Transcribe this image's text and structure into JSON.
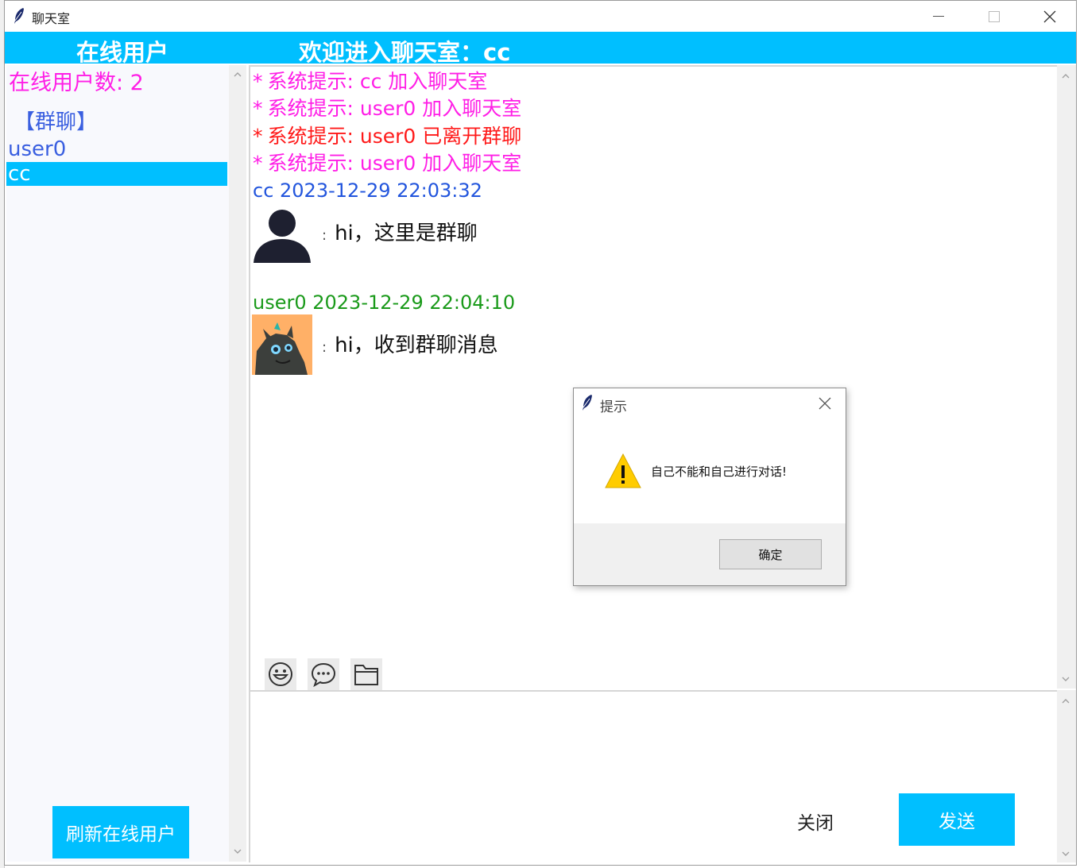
{
  "window": {
    "title": "聊天室"
  },
  "header": {
    "online_users_title": "在线用户",
    "welcome": "欢迎进入聊天室：cc"
  },
  "sidebar": {
    "online_count": "在线用户数: 2",
    "items": [
      {
        "label": "【群聊】",
        "selected": false
      },
      {
        "label": "user0",
        "selected": false
      },
      {
        "label": "cc",
        "selected": true
      }
    ],
    "refresh_label": "刷新在线用户"
  },
  "chat": {
    "system_messages": [
      {
        "star": "*",
        "text": "系统提示: cc 加入聊天室",
        "color": "#ff1ee6"
      },
      {
        "star": "*",
        "text": "系统提示: user0 加入聊天室",
        "color": "#ff1ee6"
      },
      {
        "star": "*",
        "text": "系统提示: user0 已离开群聊",
        "color": "#ff1a1a"
      },
      {
        "star": "*",
        "text": "系统提示: user0 加入聊天室",
        "color": "#ff1ee6"
      }
    ],
    "messages": [
      {
        "header": "cc 2023-12-29 22:03:32",
        "header_color": "#2255dd",
        "colon": ":",
        "text": "hi，这里是群聊",
        "avatar": "person-silhouette"
      },
      {
        "header": "user0 2023-12-29 22:04:10",
        "header_color": "#1a9a1a",
        "colon": ":",
        "text": "hi，收到群聊消息",
        "avatar": "dragon-cartoon"
      }
    ]
  },
  "toolbar": {
    "icons": [
      "emoji-icon",
      "chat-bubble-icon",
      "folder-icon"
    ]
  },
  "input": {
    "value": ""
  },
  "buttons": {
    "close_label": "关闭",
    "send_label": "发送"
  },
  "dialog": {
    "title": "提示",
    "message": "自己不能和自己进行对话!",
    "ok_label": "确定",
    "icon": "warning-icon"
  },
  "colors": {
    "accent": "#00bfff",
    "system_pink": "#ff1ee6",
    "system_red": "#ff1a1a"
  }
}
